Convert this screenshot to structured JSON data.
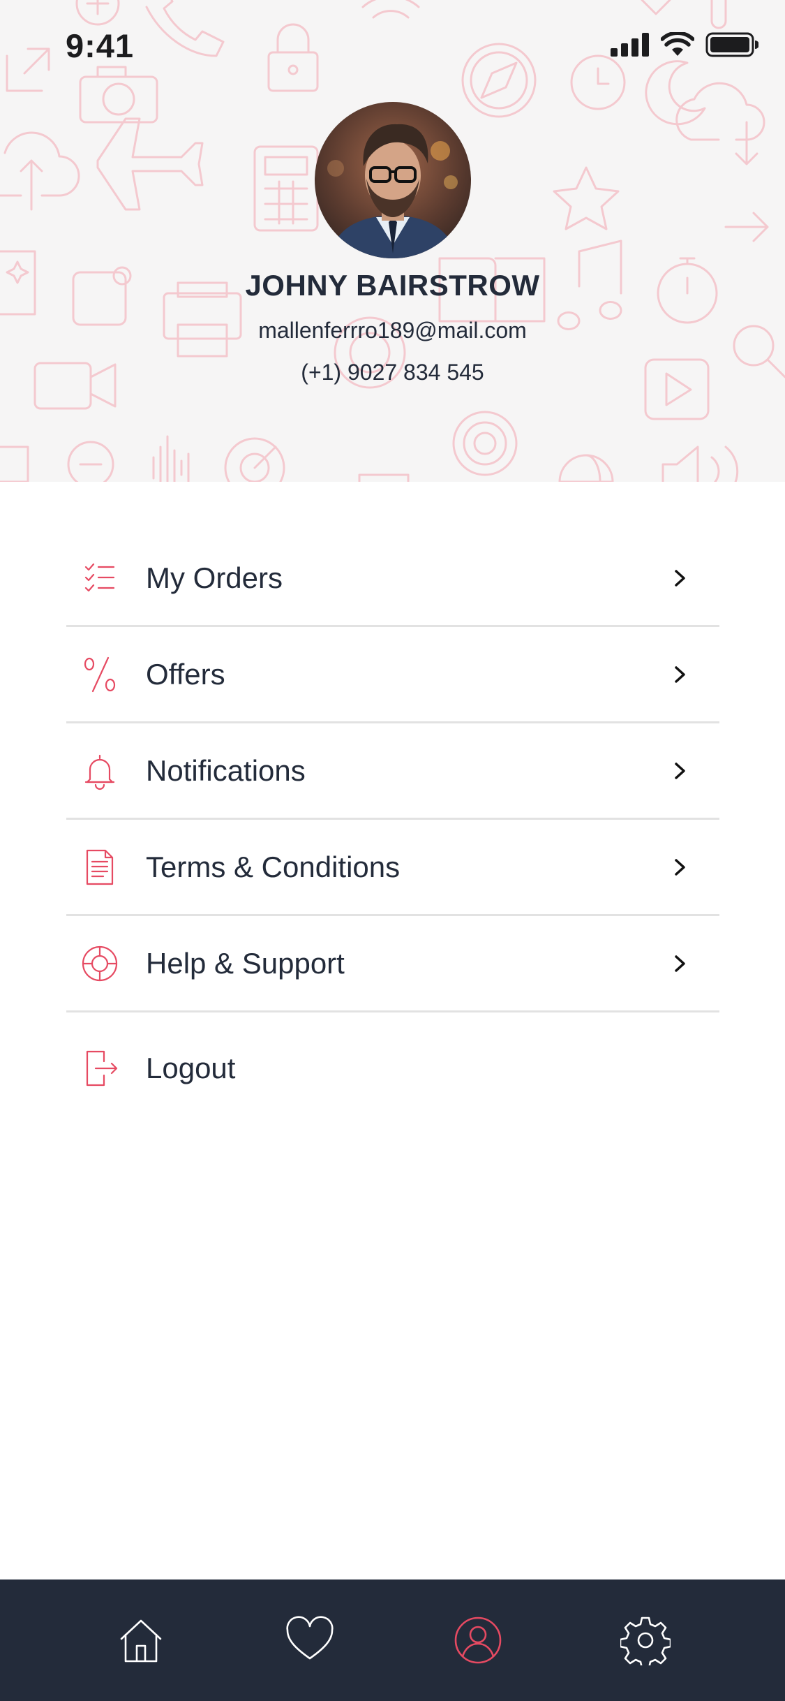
{
  "status_bar": {
    "time": "9:41",
    "icons": [
      "signal-icon",
      "wifi-icon",
      "battery-icon"
    ]
  },
  "profile": {
    "name": "JOHNY BAIRSTROW",
    "email": "mallenferrro189@mail.com",
    "phone": "(+1) 9027 834 545"
  },
  "menu": {
    "items": [
      {
        "label": "My Orders",
        "icon": "orders-list-icon"
      },
      {
        "label": "Offers",
        "icon": "percent-icon"
      },
      {
        "label": "Notifications",
        "icon": "bell-icon"
      },
      {
        "label": "Terms & Conditions",
        "icon": "document-icon"
      },
      {
        "label": "Help & Support",
        "icon": "lifebuoy-icon"
      },
      {
        "label": "Logout",
        "icon": "logout-icon"
      }
    ]
  },
  "tab_bar": {
    "tabs": [
      {
        "name": "home",
        "icon": "home-icon",
        "active": false
      },
      {
        "name": "favorites",
        "icon": "heart-icon",
        "active": false
      },
      {
        "name": "profile",
        "icon": "user-icon",
        "active": true
      },
      {
        "name": "settings",
        "icon": "gear-icon",
        "active": false
      }
    ]
  },
  "colors": {
    "accent": "#e64a62",
    "text": "#232b3a",
    "tab_bar_bg": "#232b3a",
    "header_bg": "#f6f5f5",
    "divider": "#e2e2e2"
  }
}
